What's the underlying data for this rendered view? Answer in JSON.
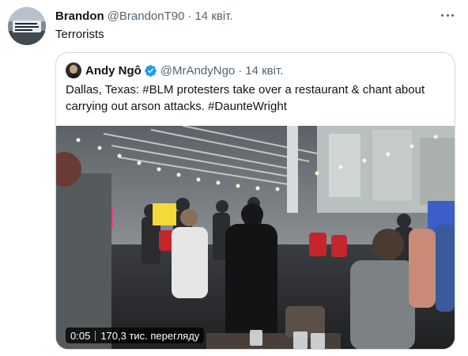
{
  "tweet": {
    "author_name": "Brandon",
    "author_handle": "@BrandonT90",
    "separator": "·",
    "date": "14 квіт.",
    "text": "Terrorists",
    "more_icon": "more-horizontal-icon"
  },
  "quoted_tweet": {
    "author_name": "Andy Ngô",
    "verified_icon": "verified-badge-icon",
    "author_handle": "@MrAndyNgo",
    "separator": "·",
    "date": "14 квіт.",
    "text": "Dallas, Texas: #BLM protesters take over a restaurant & chant about carrying out arson attacks. #DaunteWright",
    "video": {
      "duration": "0:05",
      "views": "170,3 тис. перегляду"
    }
  },
  "colors": {
    "text_primary": "#0f1419",
    "text_secondary": "#536471",
    "border": "#cfd9de",
    "verified_blue": "#1d9bf0"
  }
}
